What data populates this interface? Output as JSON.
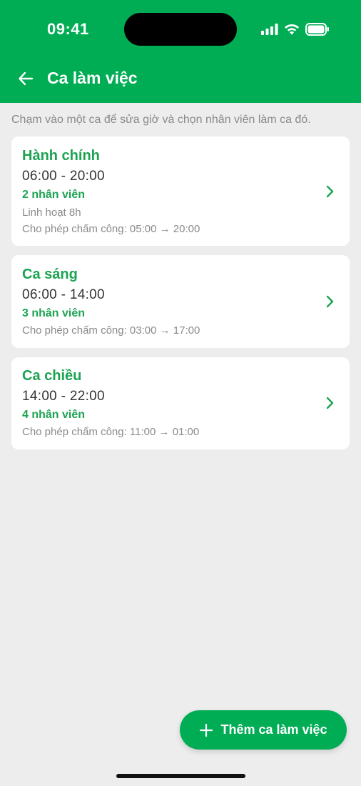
{
  "status": {
    "time": "09:41"
  },
  "header": {
    "title": "Ca làm việc"
  },
  "hint": "Chạm vào một ca để sửa giờ và chọn nhân viên làm ca đó.",
  "shifts": [
    {
      "name": "Hành chính",
      "time": "06:00 - 20:00",
      "staff": "2 nhân viên",
      "flex": "Linh hoạt 8h",
      "punch": "Cho phép chấm công: 05:00 → 20:00"
    },
    {
      "name": "Ca sáng",
      "time": "06:00 - 14:00",
      "staff": "3 nhân viên",
      "punch": "Cho phép chấm công: 03:00 → 17:00"
    },
    {
      "name": "Ca chiều",
      "time": "14:00 - 22:00",
      "staff": "4 nhân viên",
      "punch": "Cho phép chấm công: 11:00 → 01:00"
    }
  ],
  "fab": {
    "label": "Thêm ca làm việc"
  },
  "colors": {
    "brand": "#00ad55",
    "accent_text": "#1ba352",
    "background": "#ededed"
  }
}
